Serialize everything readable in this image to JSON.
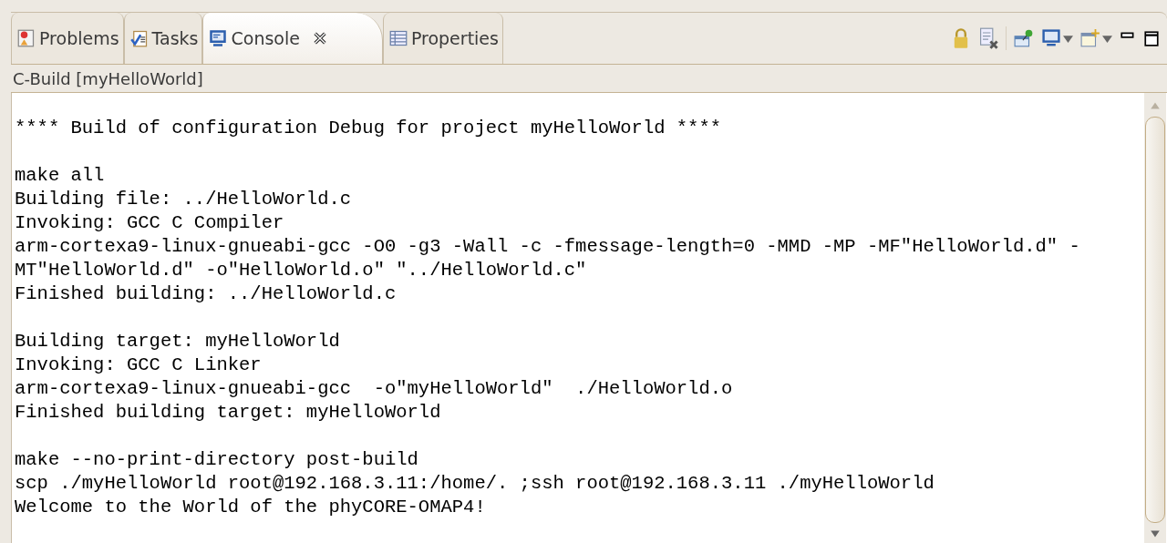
{
  "tabs": [
    {
      "label": "Problems",
      "selected": false
    },
    {
      "label": "Tasks",
      "selected": false
    },
    {
      "label": "Console",
      "selected": true
    },
    {
      "label": "Properties",
      "selected": false
    }
  ],
  "console_title": "C-Build [myHelloWorld]",
  "output_blocks": [
    [
      "**** Build of configuration Debug for project myHelloWorld ****"
    ],
    [
      "make all",
      "Building file: ../HelloWorld.c",
      "Invoking: GCC C Compiler",
      "arm-cortexa9-linux-gnueabi-gcc -O0 -g3 -Wall -c -fmessage-length=0 -MMD -MP -MF\"HelloWorld.d\" -",
      "MT\"HelloWorld.d\" -o\"HelloWorld.o\" \"../HelloWorld.c\"",
      "Finished building: ../HelloWorld.c"
    ],
    [
      "Building target: myHelloWorld",
      "Invoking: GCC C Linker",
      "arm-cortexa9-linux-gnueabi-gcc  -o\"myHelloWorld\"  ./HelloWorld.o",
      "Finished building target: myHelloWorld"
    ],
    [
      "make --no-print-directory post-build",
      "scp ./myHelloWorld root@192.168.3.11:/home/. ;ssh root@192.168.3.11 ./myHelloWorld",
      "Welcome to the World of the phyCORE-OMAP4!"
    ]
  ]
}
